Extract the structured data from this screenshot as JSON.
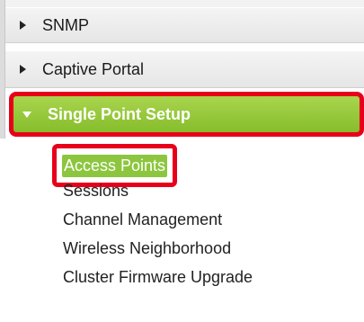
{
  "nav": {
    "items": [
      {
        "label": "SNMP",
        "state": "collapsed",
        "icon": "chevron-right-icon"
      },
      {
        "label": "Captive Portal",
        "state": "collapsed",
        "icon": "chevron-right-icon"
      },
      {
        "label": "Single Point Setup",
        "state": "expanded",
        "icon": "chevron-down-icon",
        "highlighted": true,
        "accent_color": "#8cc63e",
        "highlight_border_color": "#e8001b",
        "children": [
          {
            "label": "Access Points",
            "active": true
          },
          {
            "label": "Sessions"
          },
          {
            "label": "Channel Management"
          },
          {
            "label": "Wireless Neighborhood"
          },
          {
            "label": "Cluster Firmware Upgrade"
          }
        ]
      }
    ]
  }
}
